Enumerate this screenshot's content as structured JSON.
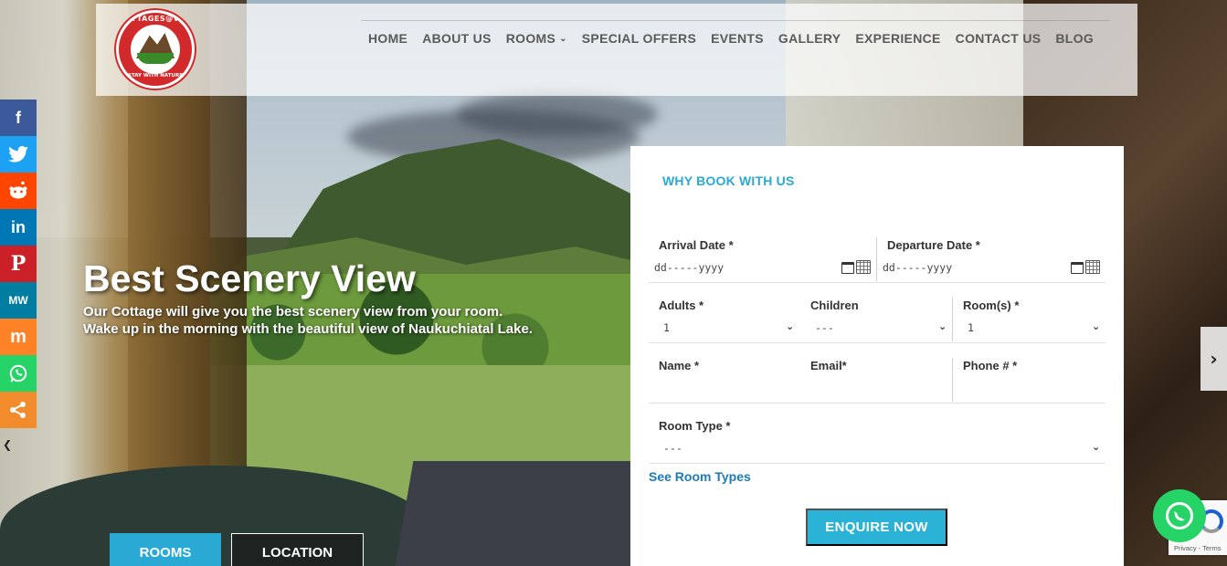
{
  "logo": {
    "top_text": "COTTAGES@VILLAGE",
    "bottom_text": "STAY WITH NATURE"
  },
  "nav": {
    "items": [
      {
        "label": "HOME"
      },
      {
        "label": "ABOUT US"
      },
      {
        "label": "ROOMS"
      },
      {
        "label": "SPECIAL OFFERS"
      },
      {
        "label": "EVENTS"
      },
      {
        "label": "GALLERY"
      },
      {
        "label": "EXPERIENCE"
      },
      {
        "label": "CONTACT US"
      },
      {
        "label": "BLOG"
      }
    ]
  },
  "social": {
    "items": [
      {
        "name": "facebook",
        "glyph": "f",
        "color": "#3b5998"
      },
      {
        "name": "twitter",
        "glyph": "t",
        "color": "#1da1f2"
      },
      {
        "name": "reddit",
        "glyph": "r",
        "color": "#ff4500"
      },
      {
        "name": "linkedin",
        "glyph": "in",
        "color": "#0077b5"
      },
      {
        "name": "pinterest",
        "glyph": "P",
        "color": "#cb2027"
      },
      {
        "name": "mewe",
        "glyph": "MW",
        "color": "#007da1"
      },
      {
        "name": "mix",
        "glyph": "m",
        "color": "#ff8226"
      },
      {
        "name": "whatsapp",
        "glyph": "w",
        "color": "#25d366"
      },
      {
        "name": "share",
        "glyph": "<",
        "color": "#f28b2b"
      }
    ]
  },
  "hero": {
    "title": "Best Scenery View",
    "subtitle": "Our Cottage will give you the best scenery view from your room. Wake up in the morning with the beautiful view of Naukuchiatal Lake.",
    "rooms_button": "ROOMS",
    "location_button": "LOCATION"
  },
  "booking": {
    "title": "WHY BOOK WITH US",
    "arrival_label": "Arrival Date *",
    "arrival_placeholder": "dd-----yyyy",
    "departure_label": "Departure Date *",
    "departure_placeholder": "dd-----yyyy",
    "adults_label": "Adults *",
    "adults_value": "1",
    "children_label": "Children",
    "children_value": "---",
    "rooms_label": "Room(s) *",
    "rooms_value": "1",
    "name_label": "Name *",
    "email_label": "Email*",
    "phone_label": "Phone # *",
    "room_type_label": "Room Type *",
    "room_type_value": "---",
    "see_room_types": "See Room Types",
    "enquire_button": "ENQUIRE NOW"
  },
  "recaptcha": {
    "text": "Privacy - Terms"
  },
  "colors": {
    "accent": "#2aa9d4",
    "link": "#1d7bb5",
    "whatsapp": "#25d366"
  }
}
